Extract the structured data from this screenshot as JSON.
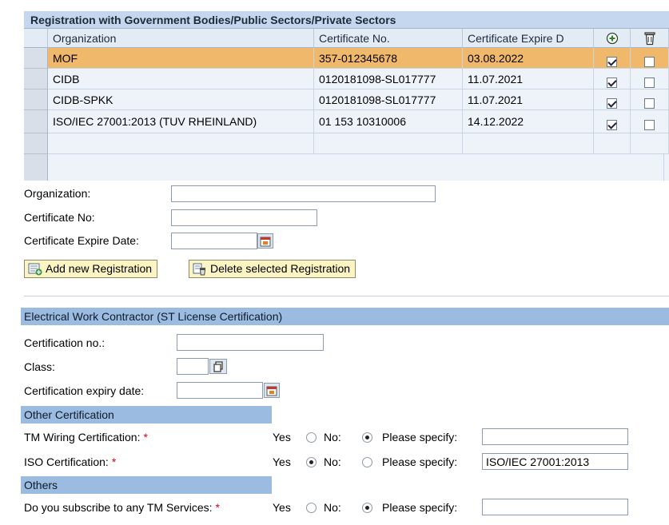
{
  "registration_table": {
    "title": "Registration with Government Bodies/Public Sectors/Private Sectors",
    "columns": [
      "Organization",
      "Certificate No.",
      "Certificate Expire D"
    ],
    "rows": [
      {
        "organization": "MOF",
        "certificate_no": "357-012345678",
        "expire": "03.08.2022",
        "checked": true,
        "delete": false,
        "selected": true
      },
      {
        "organization": "CIDB",
        "certificate_no": "0120181098-SL017777",
        "expire": "11.07.2021",
        "checked": true,
        "delete": false,
        "selected": false
      },
      {
        "organization": "CIDB-SPKK",
        "certificate_no": "0120181098-SL017777",
        "expire": "11.07.2021",
        "checked": true,
        "delete": false,
        "selected": false
      },
      {
        "organization": "ISO/IEC 27001:2013 (TUV RHEINLAND)",
        "certificate_no": "01 153 10310006",
        "expire": "14.12.2022",
        "checked": true,
        "delete": false,
        "selected": false
      }
    ],
    "icons": {
      "add_column": "add-circle-icon",
      "delete_column": "trash-icon"
    }
  },
  "registration_form": {
    "organization_label": "Organization:",
    "organization_value": "",
    "certificate_no_label": "Certificate No:",
    "certificate_no_value": "",
    "expire_label": "Certificate Expire Date:",
    "expire_value": "",
    "add_button": "Add new Registration",
    "delete_button": "Delete selected Registration"
  },
  "electrical": {
    "section_title": "Electrical Work Contractor (ST License Certification)",
    "cert_no_label": "Certification no.:",
    "cert_no_value": "",
    "class_label": "Class:",
    "class_value": "",
    "expiry_label": "Certification expiry date:",
    "expiry_value": ""
  },
  "other_cert": {
    "section_title": "Other Certification",
    "tm_wiring_label": "TM Wiring Certification:",
    "tm_wiring_selected": "no",
    "tm_wiring_specify": "",
    "iso_label": "ISO Certification:",
    "iso_selected": "yes",
    "iso_specify": "ISO/IEC 27001:2013"
  },
  "others": {
    "section_title": "Others",
    "tm_services_label": "Do you subscribe to any TM Services:",
    "tm_services_selected": "no",
    "tm_services_specify": ""
  },
  "common": {
    "yes_label": "Yes",
    "no_label": "No:",
    "specify_label": "Please specify:",
    "required_mark": "*"
  },
  "colors": {
    "selected_row": "#f0b86a",
    "section_bar": "#9cbbe0",
    "table_header": "#c5d7ee",
    "button_bg": "#fdf4c4",
    "required": "#d0021b"
  }
}
